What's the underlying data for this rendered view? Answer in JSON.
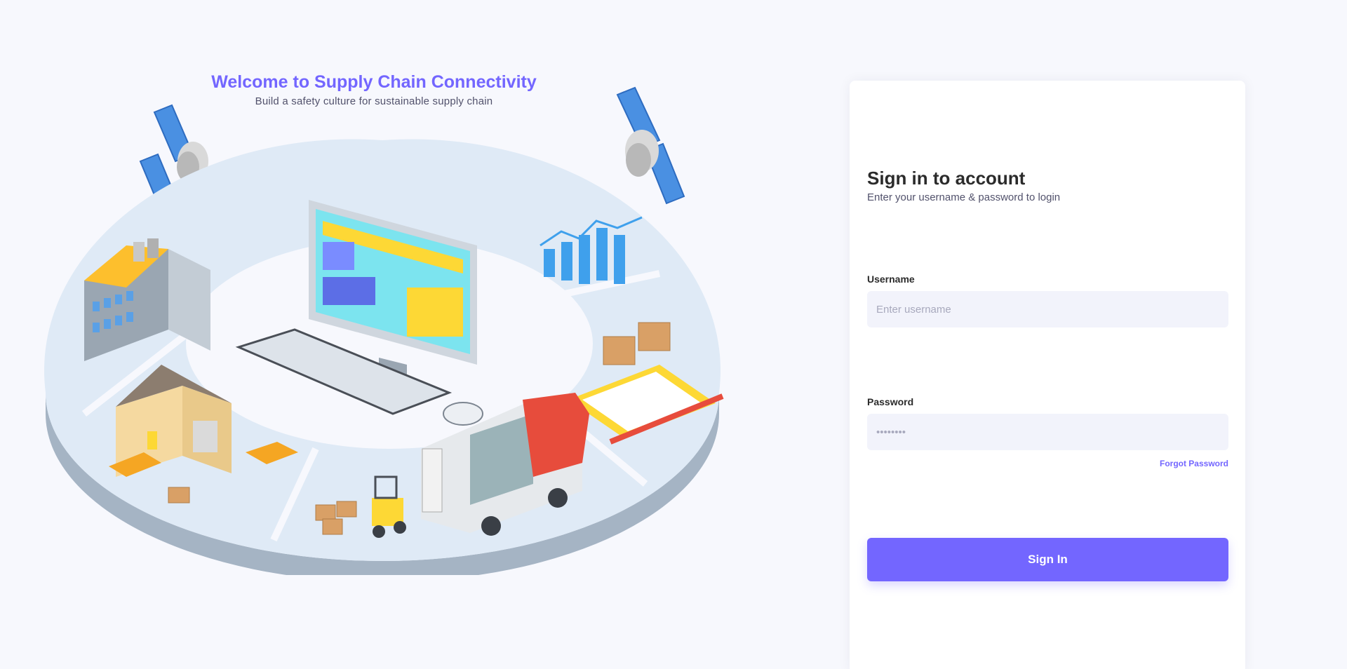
{
  "hero": {
    "title": "Welcome to Supply Chain Connectivity",
    "subtitle": "Build a safety culture for sustainable supply chain"
  },
  "login": {
    "title": "Sign in to account",
    "subtitle": "Enter your username & password to login",
    "username": {
      "label": "Username",
      "placeholder": "Enter username",
      "value": ""
    },
    "password": {
      "label": "Password",
      "placeholder": "••••••••",
      "value": ""
    },
    "forgot_password_label": "Forgot Password",
    "submit_label": "Sign In"
  },
  "colors": {
    "accent": "#7366ff",
    "background": "#f7f8fd",
    "input_background": "#f2f3fb"
  }
}
